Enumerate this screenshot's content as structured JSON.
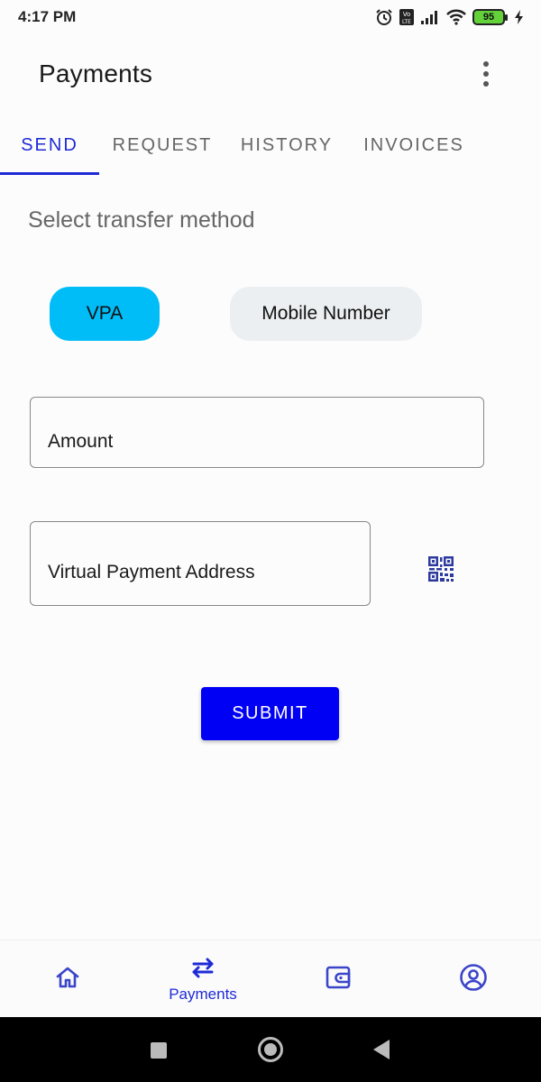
{
  "status_bar": {
    "time": "4:17 PM",
    "battery_level": "95",
    "icons": [
      "alarm-icon",
      "volte-icon",
      "signal-icon",
      "wifi-icon",
      "battery-icon",
      "charging-icon"
    ]
  },
  "app_bar": {
    "title": "Payments",
    "menu_icon": "more-vert-icon"
  },
  "tabs": [
    {
      "label": "SEND",
      "active": true
    },
    {
      "label": "REQUEST",
      "active": false
    },
    {
      "label": "HISTORY",
      "active": false
    },
    {
      "label": "INVOICES",
      "active": false
    }
  ],
  "send": {
    "section_title": "Select transfer method",
    "methods": [
      {
        "label": "VPA",
        "selected": true
      },
      {
        "label": "Mobile Number",
        "selected": false
      }
    ],
    "amount_label": "Amount",
    "vpa_label": "Virtual Payment Address",
    "qr_icon": "qr-code-icon",
    "submit_label": "SUBMIT"
  },
  "bottom_nav": [
    {
      "icon": "home-icon",
      "label": ""
    },
    {
      "icon": "swap-arrows-icon",
      "label": "Payments",
      "active": true
    },
    {
      "icon": "wallet-icon",
      "label": ""
    },
    {
      "icon": "account-icon",
      "label": ""
    }
  ],
  "colors": {
    "accent": "#1f2bd6",
    "chip_selected": "#00bdf7",
    "chip_unselected": "#eceff1",
    "submit": "#0000f5"
  }
}
